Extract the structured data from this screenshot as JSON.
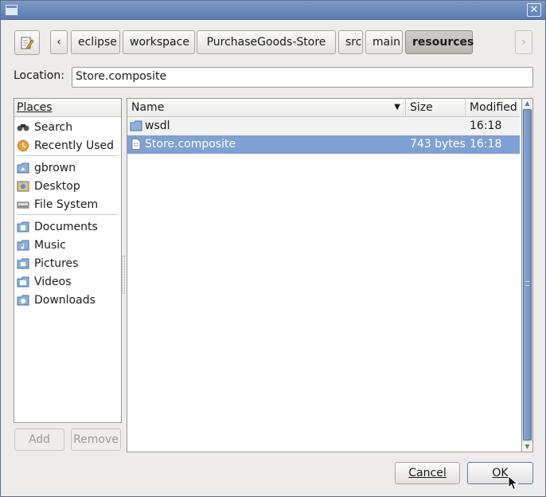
{
  "toolbar": {
    "crumbs": [
      "eclipse",
      "workspace",
      "PurchaseGoods-Store",
      "src",
      "main",
      "resources"
    ],
    "back_glyph": "‹",
    "forward_glyph": "›",
    "edit_icon": "edit-path-icon"
  },
  "location": {
    "label": "Location:",
    "value": "Store.composite"
  },
  "places": {
    "header": "Places",
    "items": [
      {
        "label": "Search",
        "icon": "search-icon"
      },
      {
        "label": "Recently Used",
        "icon": "recent-icon"
      },
      {
        "label": "gbrown",
        "icon": "home-folder-icon"
      },
      {
        "label": "Desktop",
        "icon": "desktop-icon"
      },
      {
        "label": "File System",
        "icon": "drive-icon"
      },
      {
        "label": "Documents",
        "icon": "documents-folder-icon"
      },
      {
        "label": "Music",
        "icon": "music-folder-icon"
      },
      {
        "label": "Pictures",
        "icon": "pictures-folder-icon"
      },
      {
        "label": "Videos",
        "icon": "videos-folder-icon"
      },
      {
        "label": "Downloads",
        "icon": "downloads-folder-icon"
      }
    ],
    "add_label": "Add",
    "remove_label": "Remove"
  },
  "files": {
    "columns": {
      "name": "Name",
      "size": "Size",
      "modified": "Modified"
    },
    "rows": [
      {
        "name": "wsdl",
        "size": "",
        "modified": "16:18",
        "type": "folder",
        "selected": false
      },
      {
        "name": "Store.composite",
        "size": "743 bytes",
        "modified": "16:18",
        "type": "file",
        "selected": true
      }
    ]
  },
  "actions": {
    "cancel_label": "Cancel",
    "ok_label": "OK"
  },
  "colors": {
    "selection": "#7ea0d4",
    "titlebar": "#6b89b8"
  }
}
